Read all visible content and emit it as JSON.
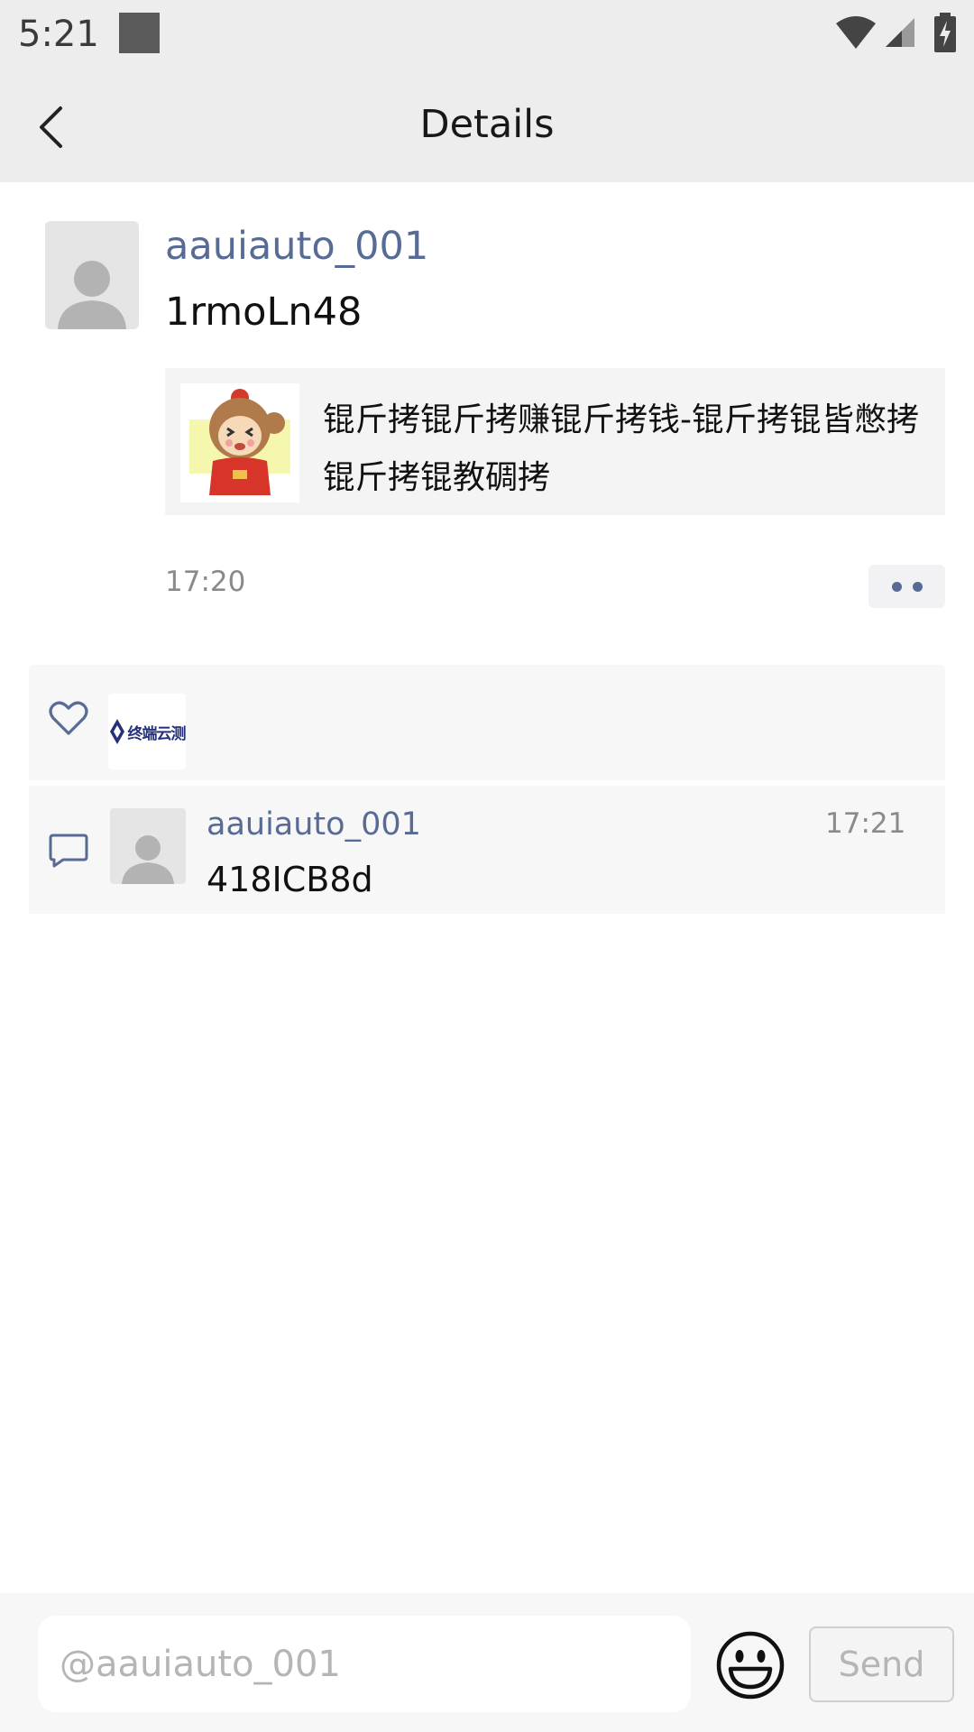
{
  "status_bar": {
    "time": "5:21",
    "icons": [
      "notification-square-icon",
      "wifi-icon",
      "cell-signal-icon",
      "battery-charging-icon"
    ]
  },
  "header": {
    "title": "Details",
    "back_icon": "chevron-left-icon"
  },
  "post": {
    "author": "aauiauto_001",
    "text": "1rmoLn48",
    "link_card": {
      "title": "锟斤拷锟斤拷赚锟斤拷钱-锟斤拷锟皆憋拷锟斤拷锟教碉拷",
      "thumbnail": "monkey-sticker-image"
    },
    "time": "17:20",
    "more_icon": "more-dots-icon"
  },
  "likes": {
    "icon": "heart-outline-icon",
    "liker_logo_text": "终端云测"
  },
  "comments": [
    {
      "author": "aauiauto_001",
      "time": "17:21",
      "text": "418ICB8d"
    }
  ],
  "input_bar": {
    "placeholder": "@aauiauto_001",
    "emoji_icon": "smiley-face-icon",
    "send_label": "Send"
  },
  "colors": {
    "bar_background": "#ededed",
    "name_link": "#576b95",
    "panel_background": "#f7f7f7",
    "muted_text": "#8a8a8a"
  }
}
